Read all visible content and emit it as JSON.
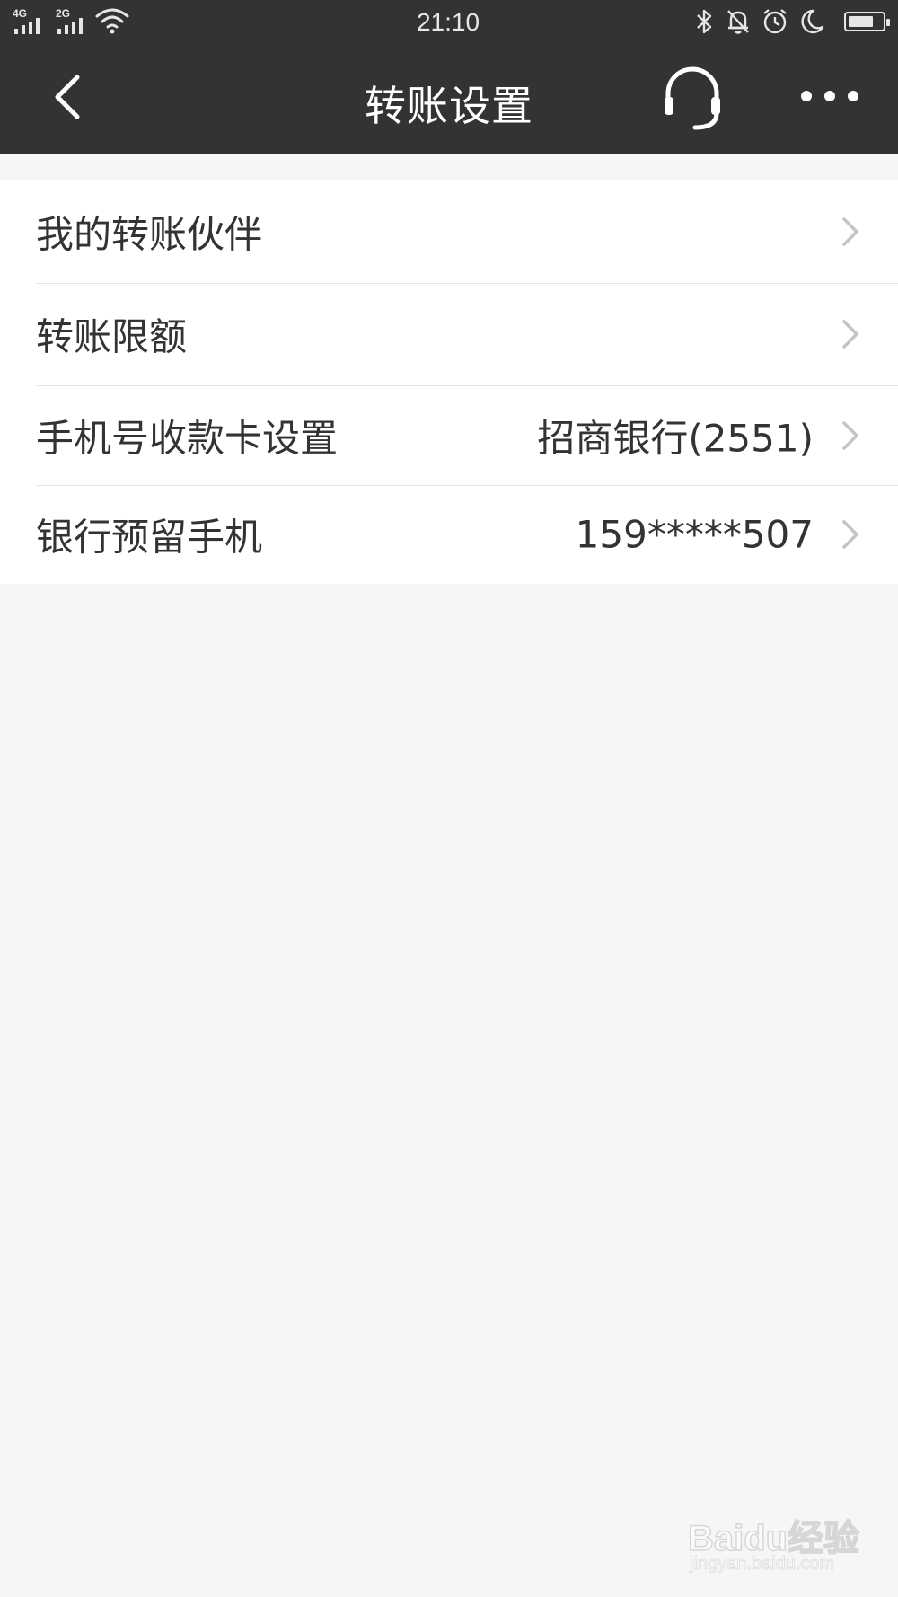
{
  "status_bar": {
    "network_1": "4G",
    "network_2": "2G",
    "time": "21:10",
    "battery_level": 0.75,
    "icons": [
      "signal-icon",
      "signal-icon",
      "wifi-icon",
      "bluetooth-icon",
      "mute-bell-icon",
      "alarm-icon",
      "moon-icon",
      "battery-icon"
    ]
  },
  "nav": {
    "title": "转账设置",
    "icons": [
      "back-icon",
      "headset-icon",
      "more-icon"
    ]
  },
  "settings": {
    "items": [
      {
        "label": "我的转账伙伴",
        "value": ""
      },
      {
        "label": "转账限额",
        "value": ""
      },
      {
        "label": "手机号收款卡设置",
        "value": "招商银行(2551)"
      },
      {
        "label": "银行预留手机",
        "value": "159*****507"
      }
    ]
  },
  "watermark": {
    "logo_text": "Baidu经验",
    "url": "jingyan.baidu.com"
  }
}
